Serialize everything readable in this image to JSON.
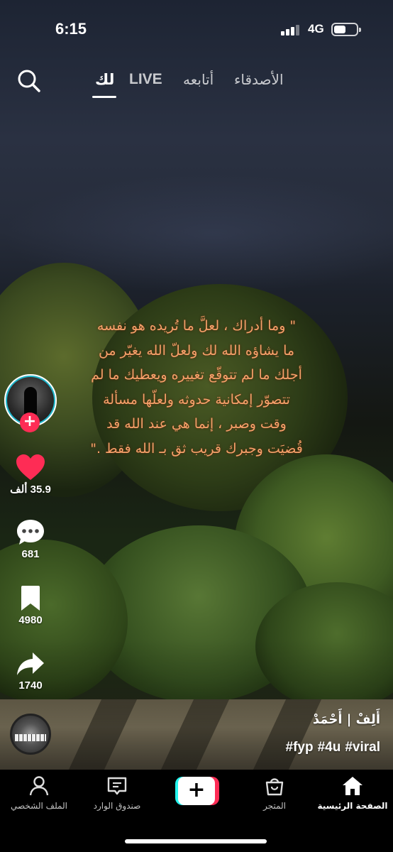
{
  "status_bar": {
    "time": "6:15",
    "network": "4G"
  },
  "top_nav": {
    "tabs": [
      {
        "label": "الأصدقاء",
        "active": false
      },
      {
        "label": "أتابعه",
        "active": false
      },
      {
        "label": "LIVE",
        "active": false
      },
      {
        "label": "لك",
        "active": true
      }
    ],
    "search_icon": "search-icon"
  },
  "video": {
    "caption_lines": [
      "\" وما أدراك ، لعلَّ ما تُريده هو نفسه",
      "ما يشاؤه الله لك ولعلّ الله يغيّر من",
      "أجلك ما لم تتوقّع تغييره ويعطيك ما لم",
      "تتصوّر إمكانية حدوثه ولعلّها مسألة",
      "وقت وصبر ، إنما هي عند الله قد",
      "قُضيَت وجبرك قريب ثق بـ الله فقط .\""
    ],
    "author": "أَلِفْ | أَحْمَدْ",
    "hashtags": [
      "#fyp",
      "#4u",
      "#viral"
    ]
  },
  "actions": {
    "follow_symbol": "+",
    "likes": "35.9 ألف",
    "comments": "681",
    "bookmarks": "4980",
    "shares": "1740",
    "like_color": "#fe2c55"
  },
  "bottom_nav": {
    "create_symbol": "+",
    "items": [
      {
        "label": "الملف الشخصي",
        "icon": "profile-icon",
        "active": false
      },
      {
        "label": "صندوق الوارد",
        "icon": "inbox-icon",
        "active": false
      },
      {
        "label": "المتجر",
        "icon": "shop-icon",
        "active": false
      },
      {
        "label": "الصفحة الرئيسية",
        "icon": "home-icon",
        "active": true
      }
    ]
  }
}
